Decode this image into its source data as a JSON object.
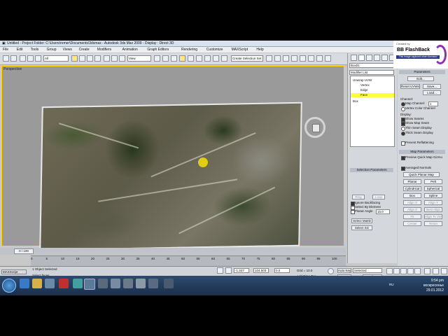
{
  "window": {
    "title": "Untitled - Project Folder: C:\\Users\\remer\\Documents\\3dsmax - Autodesk 3ds Max 2009 - Display : Direct 3D"
  },
  "menu": [
    "File",
    "Edit",
    "Tools",
    "Group",
    "Views",
    "Create",
    "Modifiers",
    "Animation",
    "Graph Editors",
    "Rendering",
    "Customize",
    "MAXScript",
    "Help"
  ],
  "toolbar": {
    "selection_filter": "All",
    "ref_coord": "View",
    "named_selection": "Create Selection Set"
  },
  "viewport": {
    "label": "Perspective"
  },
  "command_panel": {
    "object_name": "Box01",
    "modifier_list": "Modifier List",
    "stack": [
      "Unwrap UVW",
      "Vertex",
      "Edge",
      "Face",
      "Box"
    ],
    "selected_subobject": "Face",
    "selection_params_title": "Selection Parameters",
    "ignore_backfacing": "Ignore Backfacing",
    "select_by_element": "Select By Element",
    "planar_angle_label": "Planar Angle",
    "planar_angle_value": "15.0",
    "ring": "Ring",
    "loop": "Loop",
    "select_matid": "Select MatID",
    "select_sg": "Select SG"
  },
  "right_panel": {
    "parameters_title": "Parameters",
    "edit": "Edit...",
    "reset_uvws": "Reset UVWs",
    "save": "Save...",
    "load": "Load...",
    "channel_title": "Channel:",
    "map_channel": "Map Channel:",
    "map_channel_value": "1",
    "vertex_color_channel": "Vertex Color Channel",
    "display_title": "Display:",
    "show_seams": "Show Seams",
    "show_map_seam": "Show Map Seam",
    "thin_seam": "Thin Seam Display",
    "thick_seam": "Thick Seam Display",
    "prevent_reflattening": "Prevent Reflattening",
    "map_params_title": "Map Parameters",
    "preview_quick_map": "Preview Quick Map Gizmo",
    "averaged_normals": "Averaged Normals",
    "quick_planar_map": "Quick Planar Map",
    "map_buttons": [
      "Planar",
      "Pelt",
      "Cylindrical",
      "Spherical",
      "Box",
      "Spline",
      "Align X",
      "Align Y",
      "Align Z",
      "Best Align",
      "Fit",
      "Align To View",
      "Center",
      "Reset"
    ]
  },
  "timeline": {
    "frame": "0 / 100",
    "ticks": [
      "0",
      "5",
      "10",
      "15",
      "20",
      "25",
      "30",
      "35",
      "40",
      "45",
      "50",
      "55",
      "60",
      "65",
      "70",
      "75",
      "80",
      "85",
      "90",
      "95",
      "100"
    ]
  },
  "status": {
    "objects_selected": "1 Object Selected",
    "prompt": "Select faces",
    "x_value": "-1.347",
    "y_value": "104.503",
    "z_value": "0.0",
    "grid": "Grid = 10.0",
    "add_time_tag": "Add Time Tag",
    "auto_key": "Auto Key",
    "set_key": "Set Key",
    "selected": "Selected",
    "key_filters": "Key Filters...",
    "maxscript": "MAXScript"
  },
  "taskbar": {
    "lang": "RU",
    "time": "9:54 pm",
    "day": "воскресенье",
    "date": "29.01.2012"
  },
  "watermark": {
    "caption": "Created by",
    "name": "BB FlashBack",
    "tag": "This image captured when licensed"
  },
  "colors": {
    "viewport_border": "#ffd400",
    "selection_highlight": "#ffff3c",
    "taskbar": "#1b2f4a"
  }
}
